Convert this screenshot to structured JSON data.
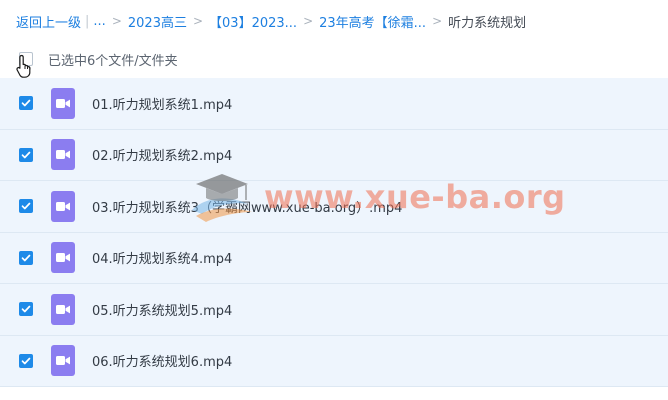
{
  "breadcrumb": {
    "back": "返回上一级",
    "ellipsis": "...",
    "items": [
      "2023高三",
      "【03】2023...",
      "23年高考【徐霜..."
    ],
    "current": "听力系统规划"
  },
  "selection": {
    "text": "已选中6个文件/文件夹"
  },
  "files": [
    {
      "name": "01.听力规划系统1.mp4"
    },
    {
      "name": "02.听力规划系统2.mp4"
    },
    {
      "name": "03.听力规划系统3（学霸网www.xue-ba.org）.mp4"
    },
    {
      "name": "04.听力规划系统4.mp4"
    },
    {
      "name": "05.听力系统规划5.mp4"
    },
    {
      "name": "06.听力系统规划6.mp4"
    }
  ],
  "watermark": {
    "text": "www.xue-ba.org"
  },
  "colors": {
    "link": "#1d7fe0",
    "checkbox": "#1e8ae8",
    "row_bg": "#eef5fd",
    "video_icon": "#8b7df0",
    "watermark": "#f06e50"
  },
  "icons": {
    "file": "video-file-icon",
    "check": "check-icon",
    "cursor": "hand-pointer-icon",
    "logo": "graduation-cap-icon"
  }
}
